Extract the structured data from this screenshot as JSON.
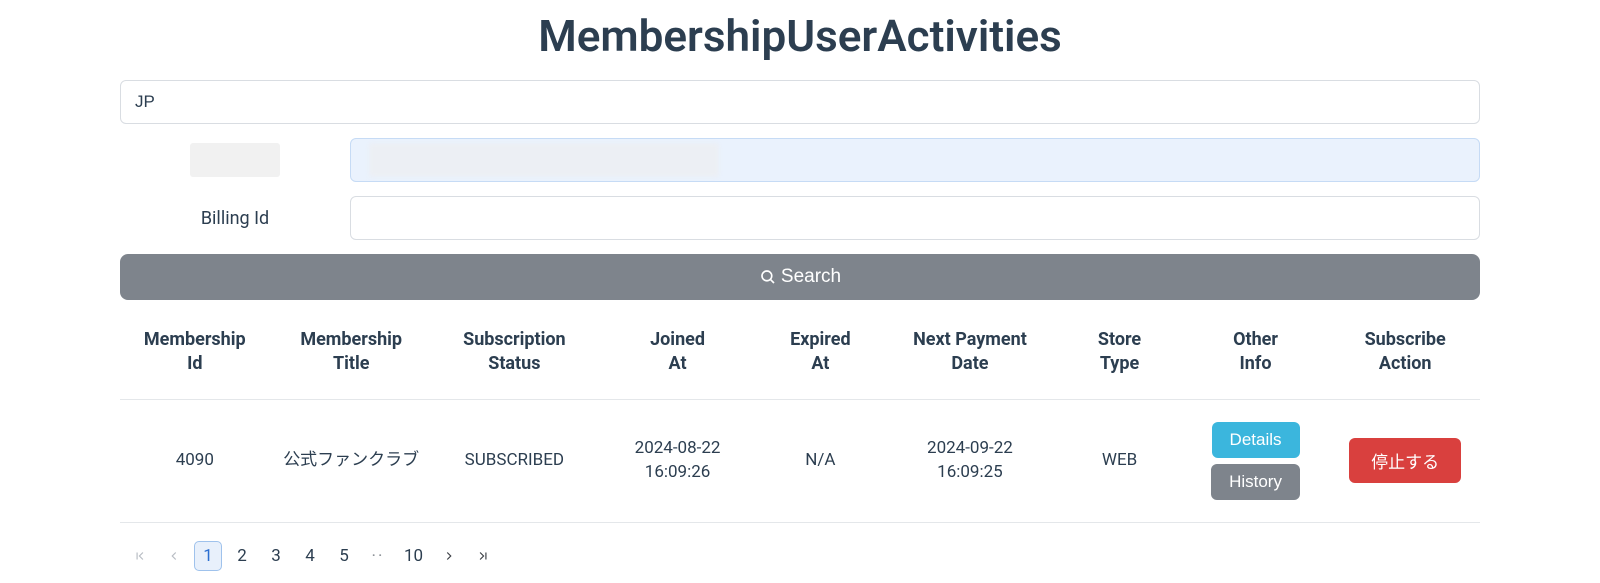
{
  "title": "MembershipUserActivities",
  "filters": {
    "country_value": "JP",
    "field2_label_redacted": true,
    "field2_value_redacted": true,
    "billing_label": "Billing Id",
    "billing_value": ""
  },
  "search_button": "Search",
  "table": {
    "headers": {
      "membership_id": "Membership Id",
      "membership_title": "Membership Title",
      "subscription_status": "Subscription Status",
      "joined_at": "Joined At",
      "expired_at": "Expired At",
      "next_payment_date": "Next Payment Date",
      "store_type": "Store Type",
      "other_info": "Other Info",
      "subscribe_action": "Subscribe Action"
    },
    "rows": [
      {
        "membership_id": "4090",
        "membership_title": "公式ファンクラブ",
        "subscription_status": "SUBSCRIBED",
        "joined_at": "2024-08-22 16:09:26",
        "expired_at": "N/A",
        "next_payment_date": "2024-09-22 16:09:25",
        "store_type": "WEB"
      }
    ],
    "buttons": {
      "details": "Details",
      "history": "History",
      "stop": "停止する"
    }
  },
  "pagination": {
    "pages": [
      "1",
      "2",
      "3",
      "4",
      "5"
    ],
    "last": "10",
    "active": "1"
  }
}
